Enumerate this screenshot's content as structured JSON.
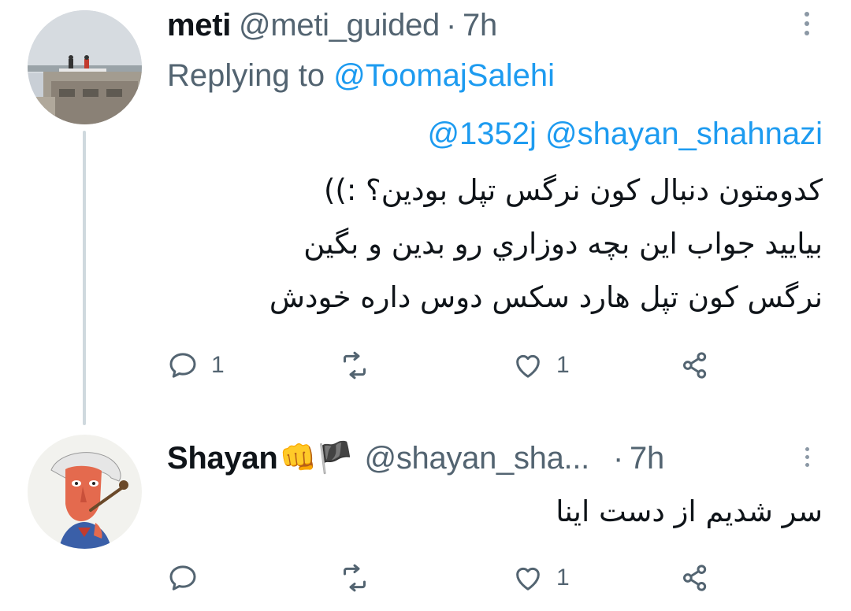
{
  "tweets": [
    {
      "name": "meti",
      "handle": "@meti_guided",
      "separator": "·",
      "time": "7h",
      "replying_to_prefix": "Replying to",
      "replying_to_handle": "@ToomajSalehi",
      "mentions": "@1352j @shayan_shahnazi",
      "body_lines": [
        "کدومتون دنبال کون نرگس تپل بودین؟ :))",
        "بیایید جواب این بچه دوزاري رو بدین و بگین",
        "نرگس کون تپل هارد سکس دوس داره خودش"
      ],
      "reply_count": "1",
      "retweet_count": "",
      "like_count": "1",
      "icons": [
        "comment-icon",
        "retweet-icon",
        "heart-icon",
        "share-icon",
        "more-icon"
      ]
    },
    {
      "name": "Shayan",
      "emojis": "👊🏴",
      "handle": "@shayan_sha...",
      "separator": "·",
      "time": "7h",
      "body_lines": [
        "سر شدیم از دست اینا"
      ],
      "reply_count": "",
      "retweet_count": "",
      "like_count": "1",
      "icons": [
        "comment-icon",
        "retweet-icon",
        "heart-icon",
        "share-icon",
        "more-icon"
      ]
    }
  ],
  "colors": {
    "link": "#1d9bf0",
    "muted": "#536471",
    "thread_line": "#cfd9de"
  }
}
